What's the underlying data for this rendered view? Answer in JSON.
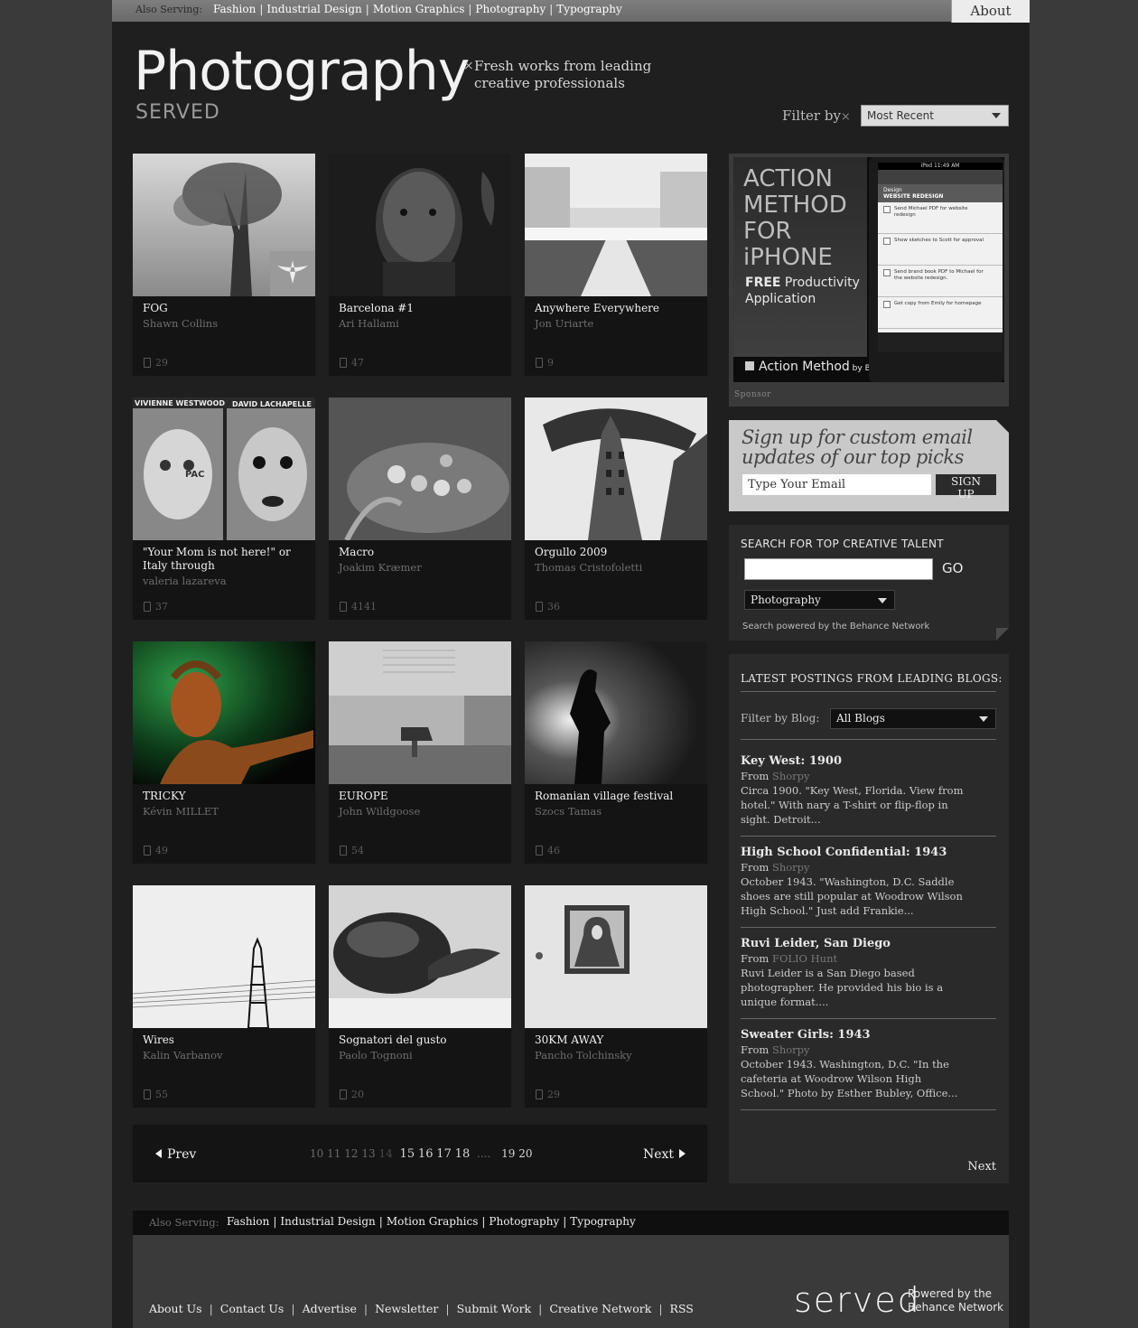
{
  "top_bar": {
    "also_serving_label": "Also Serving:",
    "links": [
      "Fashion",
      "Industrial Design",
      "Motion Graphics",
      "Photography",
      "Typography"
    ],
    "about_label": "About"
  },
  "header": {
    "title": "Photography",
    "subtitle": "SERVED",
    "tagline_line1": "Fresh works from leading",
    "tagline_line2": "creative professionals",
    "tagline_icon": "×",
    "filter_label": "Filter by",
    "filter_icon": "×",
    "filter_value": "Most Recent"
  },
  "gallery": [
    {
      "title": "FOG",
      "author": "Shawn Collins",
      "count": "29"
    },
    {
      "title": "Barcelona #1",
      "author": "Ari Hallami",
      "count": "47"
    },
    {
      "title": "Anywhere Everywhere",
      "author": "Jon Uriarte",
      "count": "9"
    },
    {
      "title": "\"Your Mom is not here!\" or Italy through",
      "author": "valeria lazareva",
      "count": "37"
    },
    {
      "title": "Macro",
      "author": "Joakim Kræmer",
      "count": "4141"
    },
    {
      "title": "Orgullo 2009",
      "author": "Thomas Cristofoletti",
      "count": "36"
    },
    {
      "title": "TRICKY",
      "author": "Kévin MILLET",
      "count": "49"
    },
    {
      "title": "EUROPE",
      "author": "John Wildgoose",
      "count": "54"
    },
    {
      "title": "Romanian village festival",
      "author": "Szocs Tamas",
      "count": "46"
    },
    {
      "title": "Wires",
      "author": "Kalin Varbanov",
      "count": "55"
    },
    {
      "title": "Sognatori del gusto",
      "author": "Paolo Tognoni",
      "count": "20"
    },
    {
      "title": "30KM AWAY",
      "author": "Pancho Tolchinsky",
      "count": "29"
    }
  ],
  "thumb_overlay_text": {
    "vivienne": "VIVIENNE WESTWOOD",
    "david": "DAVID LACHAPELLE",
    "pac": "PAC"
  },
  "pager": {
    "prev_label": "Prev",
    "next_label": "Next",
    "pages_dim": [
      "10",
      "11",
      "12",
      "13"
    ],
    "page_current": "14",
    "pages_on": [
      "15",
      "16",
      "17",
      "18"
    ],
    "ellipsis": "....",
    "pages_end": [
      "19",
      "20"
    ]
  },
  "ad": {
    "title": "ACTION METHOD FOR iPHONE",
    "free": "FREE",
    "sub": " Productivity Application",
    "brand": "Action Method",
    "brand_by": " by Behance™",
    "sponsor": "Sponsor",
    "phone": {
      "status": "iPod 11:49 AM",
      "header_small": "Design",
      "header": "WEBSITE REDESIGN",
      "tasks": [
        "Send Michael PDF for website redesign",
        "Show sketches to Scott for approval",
        "Send brand book PDF to Michael for the website redesign.",
        "Get copy from Emily for homepage"
      ]
    }
  },
  "signup": {
    "heading": "Sign up for custom email updates of our top picks",
    "email_placeholder": "Type Your Email",
    "button": "SIGN UP"
  },
  "search": {
    "heading": "SEARCH FOR TOP CREATIVE TALENT",
    "go": "GO",
    "category": "Photography",
    "powered": "Search powered by the Behance Network"
  },
  "blogs": {
    "heading": "LATEST POSTINGS FROM LEADING BLOGS:",
    "filter_label": "Filter by Blog:",
    "filter_value": "All Blogs",
    "from_label": "From",
    "posts": [
      {
        "title": "Key West: 1900",
        "source": "Shorpy",
        "body": "Circa 1900. \"Key West, Florida. View from hotel.\" With nary a T-shirt or flip-flop in sight. Detroit..."
      },
      {
        "title": "High School Confidential: 1943",
        "source": "Shorpy",
        "body": "October 1943. \"Washington, D.C. Saddle shoes are still popular at Woodrow Wilson High School.\" Just add Frankie..."
      },
      {
        "title": "Ruvi Leider, San Diego",
        "source": "FOLIO Hunt",
        "body": "  Ruvi Leider is a San Diego based photographer.  He provided his bio is a unique format...."
      },
      {
        "title": "Sweater Girls: 1943",
        "source": "Shorpy",
        "body": "October 1943. Washington, D.C. \"In the cafeteria at Woodrow Wilson High School.\" Photo by Esther Bubley, Office..."
      }
    ],
    "next_label": "Next"
  },
  "footer": {
    "also_serving_label": "Also Serving:",
    "serving_links": [
      "Fashion",
      "Industrial Design",
      "Motion Graphics",
      "Photography",
      "Typography"
    ],
    "links": [
      "About Us",
      "Contact Us",
      "Advertise",
      "Newsletter",
      "Submit Work",
      "Creative Network",
      "RSS"
    ],
    "logo": "served",
    "powered_line1": "Powered by the",
    "powered_line2": "Behance Network"
  },
  "colors": {
    "page_bg": "#3a3a3a",
    "content_bg": "#1f1f1f",
    "card_bg": "#141414",
    "signup_bg": "#c9c9c9"
  }
}
